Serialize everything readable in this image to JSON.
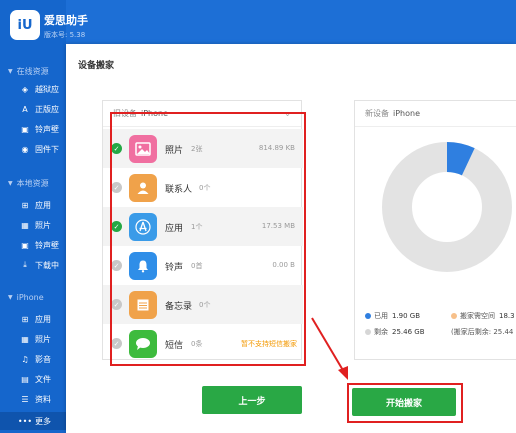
{
  "app": {
    "name": "爱思助手",
    "version": "版本号: 5.38",
    "logo_text": "iU"
  },
  "sidebar": {
    "sections": [
      {
        "label": "在线资源",
        "items": [
          {
            "label": "越狱应",
            "icon": "box-icon"
          },
          {
            "label": "正版应",
            "icon": "app-store-icon"
          },
          {
            "label": "铃声壁",
            "icon": "ringtone-icon"
          },
          {
            "label": "固件下",
            "icon": "firmware-icon"
          }
        ]
      },
      {
        "label": "本地资源",
        "items": [
          {
            "label": "应用",
            "icon": "apps-icon"
          },
          {
            "label": "照片",
            "icon": "photo-icon"
          },
          {
            "label": "铃声壁",
            "icon": "ringtone-icon"
          },
          {
            "label": "下载中",
            "icon": "download-icon"
          }
        ]
      },
      {
        "label": "iPhone",
        "items": [
          {
            "label": "应用",
            "icon": "apps-icon"
          },
          {
            "label": "照片",
            "icon": "photo-icon"
          },
          {
            "label": "影音",
            "icon": "media-icon"
          },
          {
            "label": "文件",
            "icon": "file-icon"
          },
          {
            "label": "资料",
            "icon": "contacts-icon"
          },
          {
            "label": "更多",
            "icon": "more-icon"
          }
        ]
      }
    ]
  },
  "dialog": {
    "title": "设备搬家",
    "old_device": {
      "label": "旧设备",
      "name": "iPhone",
      "items": [
        {
          "name": "照片",
          "count": "2张",
          "size": "814.89 KB",
          "checked": true,
          "icon": "photo-icon",
          "color": "#f06fa0"
        },
        {
          "name": "联系人",
          "count": "0个",
          "size": "",
          "checked": false,
          "icon": "contacts-icon",
          "color": "#f0a24a"
        },
        {
          "name": "应用",
          "count": "1个",
          "size": "17.53 MB",
          "checked": true,
          "icon": "app-store-icon",
          "color": "#3a9be8"
        },
        {
          "name": "铃声",
          "count": "0首",
          "size": "0.00 B",
          "checked": false,
          "icon": "bell-icon",
          "color": "#2f8ee8"
        },
        {
          "name": "备忘录",
          "count": "0个",
          "size": "",
          "checked": false,
          "icon": "notes-icon",
          "color": "#f0a24a"
        },
        {
          "name": "短信",
          "count": "0条",
          "size": "",
          "note": "暂不支持短信搬家",
          "checked": false,
          "icon": "message-icon",
          "color": "#3dbb3d"
        }
      ]
    },
    "new_device": {
      "label": "新设备",
      "name": "iPhone",
      "legend": [
        {
          "label": "已用",
          "value": "1.90 GB",
          "color": "#2f7fe0"
        },
        {
          "label": "搬家需空间",
          "value": "18.3",
          "color": "#f7c08a"
        },
        {
          "label": "剩余",
          "value": "25.46 GB",
          "color": "#d6d6d6"
        },
        {
          "label": "(搬家后剩余",
          "value": ": 25.44",
          "color": ""
        }
      ],
      "storage": {
        "used_fraction": 0.07,
        "needed_fraction": 0.001
      }
    },
    "buttons": {
      "prev": "上一步",
      "start": "开始搬家"
    }
  }
}
